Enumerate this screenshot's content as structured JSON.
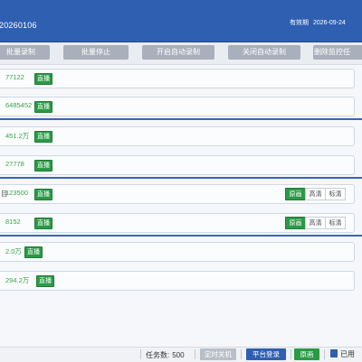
{
  "header": {
    "app_title": "20260106",
    "expiry_label": "有效期",
    "expiry_date": "2026-09-24"
  },
  "toolbar": {
    "buttons": [
      "批量录制",
      "批量停止",
      "开启自动录制",
      "关闭自动录制",
      "删除监控任"
    ]
  },
  "rows": [
    {
      "prefix": "",
      "count": "77122",
      "badge": "直播",
      "quality": null
    },
    {
      "prefix": "",
      "count": "6485452",
      "badge": "直播",
      "quality": null
    },
    {
      "prefix": "",
      "count": "451.2万",
      "badge": "直播",
      "quality": null
    },
    {
      "prefix": "",
      "count": "27778",
      "badge": "直播",
      "quality": null
    },
    {
      "prefix": "目",
      "count": "123500",
      "badge": "直播",
      "quality": {
        "options": [
          "原画",
          "高清",
          "标清"
        ],
        "selected": "原画"
      }
    },
    {
      "prefix": "",
      "count": "8152",
      "badge": "直播",
      "quality": {
        "options": [
          "原画",
          "高清",
          "标清"
        ],
        "selected": "原画"
      }
    },
    {
      "prefix": "",
      "count": "2.0万",
      "badge": "直播",
      "quality": null
    },
    {
      "prefix": "",
      "count": "294.2万",
      "badge": "直播",
      "quality": null
    }
  ],
  "statusbar": {
    "task_label": "任务数:",
    "task_count": "500",
    "shutdown_label": "定时关机",
    "login_label": "平台登录",
    "quality_label": "原画",
    "used_label": "已用"
  },
  "colors": {
    "header_bg": "#2f5fb0",
    "live_green": "#2a9a45",
    "count_green": "#3aa54a",
    "toolbar_btn": "#a9b0bb"
  }
}
